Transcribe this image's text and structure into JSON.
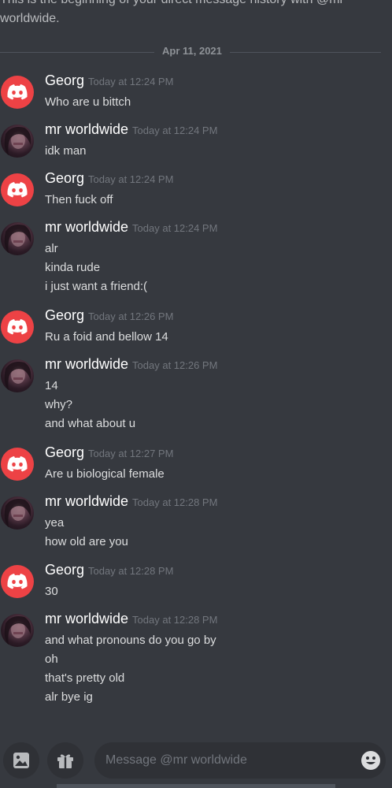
{
  "intro_text": "This is the beginning of your direct message history with @mr worldwide.",
  "date_divider": "Apr 11, 2021",
  "messages": [
    {
      "author": "Georg",
      "avatar": "discord-logo-icon",
      "time": "Today at 12:24 PM",
      "lines": [
        "Who are u bittch"
      ]
    },
    {
      "author": "mr worldwide",
      "avatar": "user-photo",
      "time": "Today at 12:24 PM",
      "lines": [
        "idk man"
      ]
    },
    {
      "author": "Georg",
      "avatar": "discord-logo-icon",
      "time": "Today at 12:24 PM",
      "lines": [
        "Then fuck off"
      ]
    },
    {
      "author": "mr worldwide",
      "avatar": "user-photo",
      "time": "Today at 12:24 PM",
      "lines": [
        "alr",
        "kinda rude",
        "i just want a friend:("
      ]
    },
    {
      "author": "Georg",
      "avatar": "discord-logo-icon",
      "time": "Today at 12:26 PM",
      "lines": [
        "Ru a foid and bellow 14"
      ]
    },
    {
      "author": "mr worldwide",
      "avatar": "user-photo",
      "time": "Today at 12:26 PM",
      "lines": [
        "14",
        "why?",
        "and what about u"
      ]
    },
    {
      "author": "Georg",
      "avatar": "discord-logo-icon",
      "time": "Today at 12:27 PM",
      "lines": [
        "Are u biological female"
      ]
    },
    {
      "author": "mr worldwide",
      "avatar": "user-photo",
      "time": "Today at 12:28 PM",
      "lines": [
        "yea",
        "how old are you"
      ]
    },
    {
      "author": "Georg",
      "avatar": "discord-logo-icon",
      "time": "Today at 12:28 PM",
      "lines": [
        "30"
      ]
    },
    {
      "author": "mr worldwide",
      "avatar": "user-photo",
      "time": "Today at 12:28 PM",
      "lines": [
        "and what pronouns do you go by",
        "oh",
        "that's pretty old",
        "alr bye ig"
      ]
    }
  ],
  "composer": {
    "placeholder": "Message @mr worldwide",
    "image_icon": "image-icon",
    "gift_icon": "gift-icon",
    "emoji_icon": "emoji-icon"
  },
  "colors": {
    "background": "#36393f",
    "discord_red": "#ed4245",
    "author_text": "#ffffff",
    "timestamp": "#72767d",
    "message_text": "#dcddde"
  }
}
